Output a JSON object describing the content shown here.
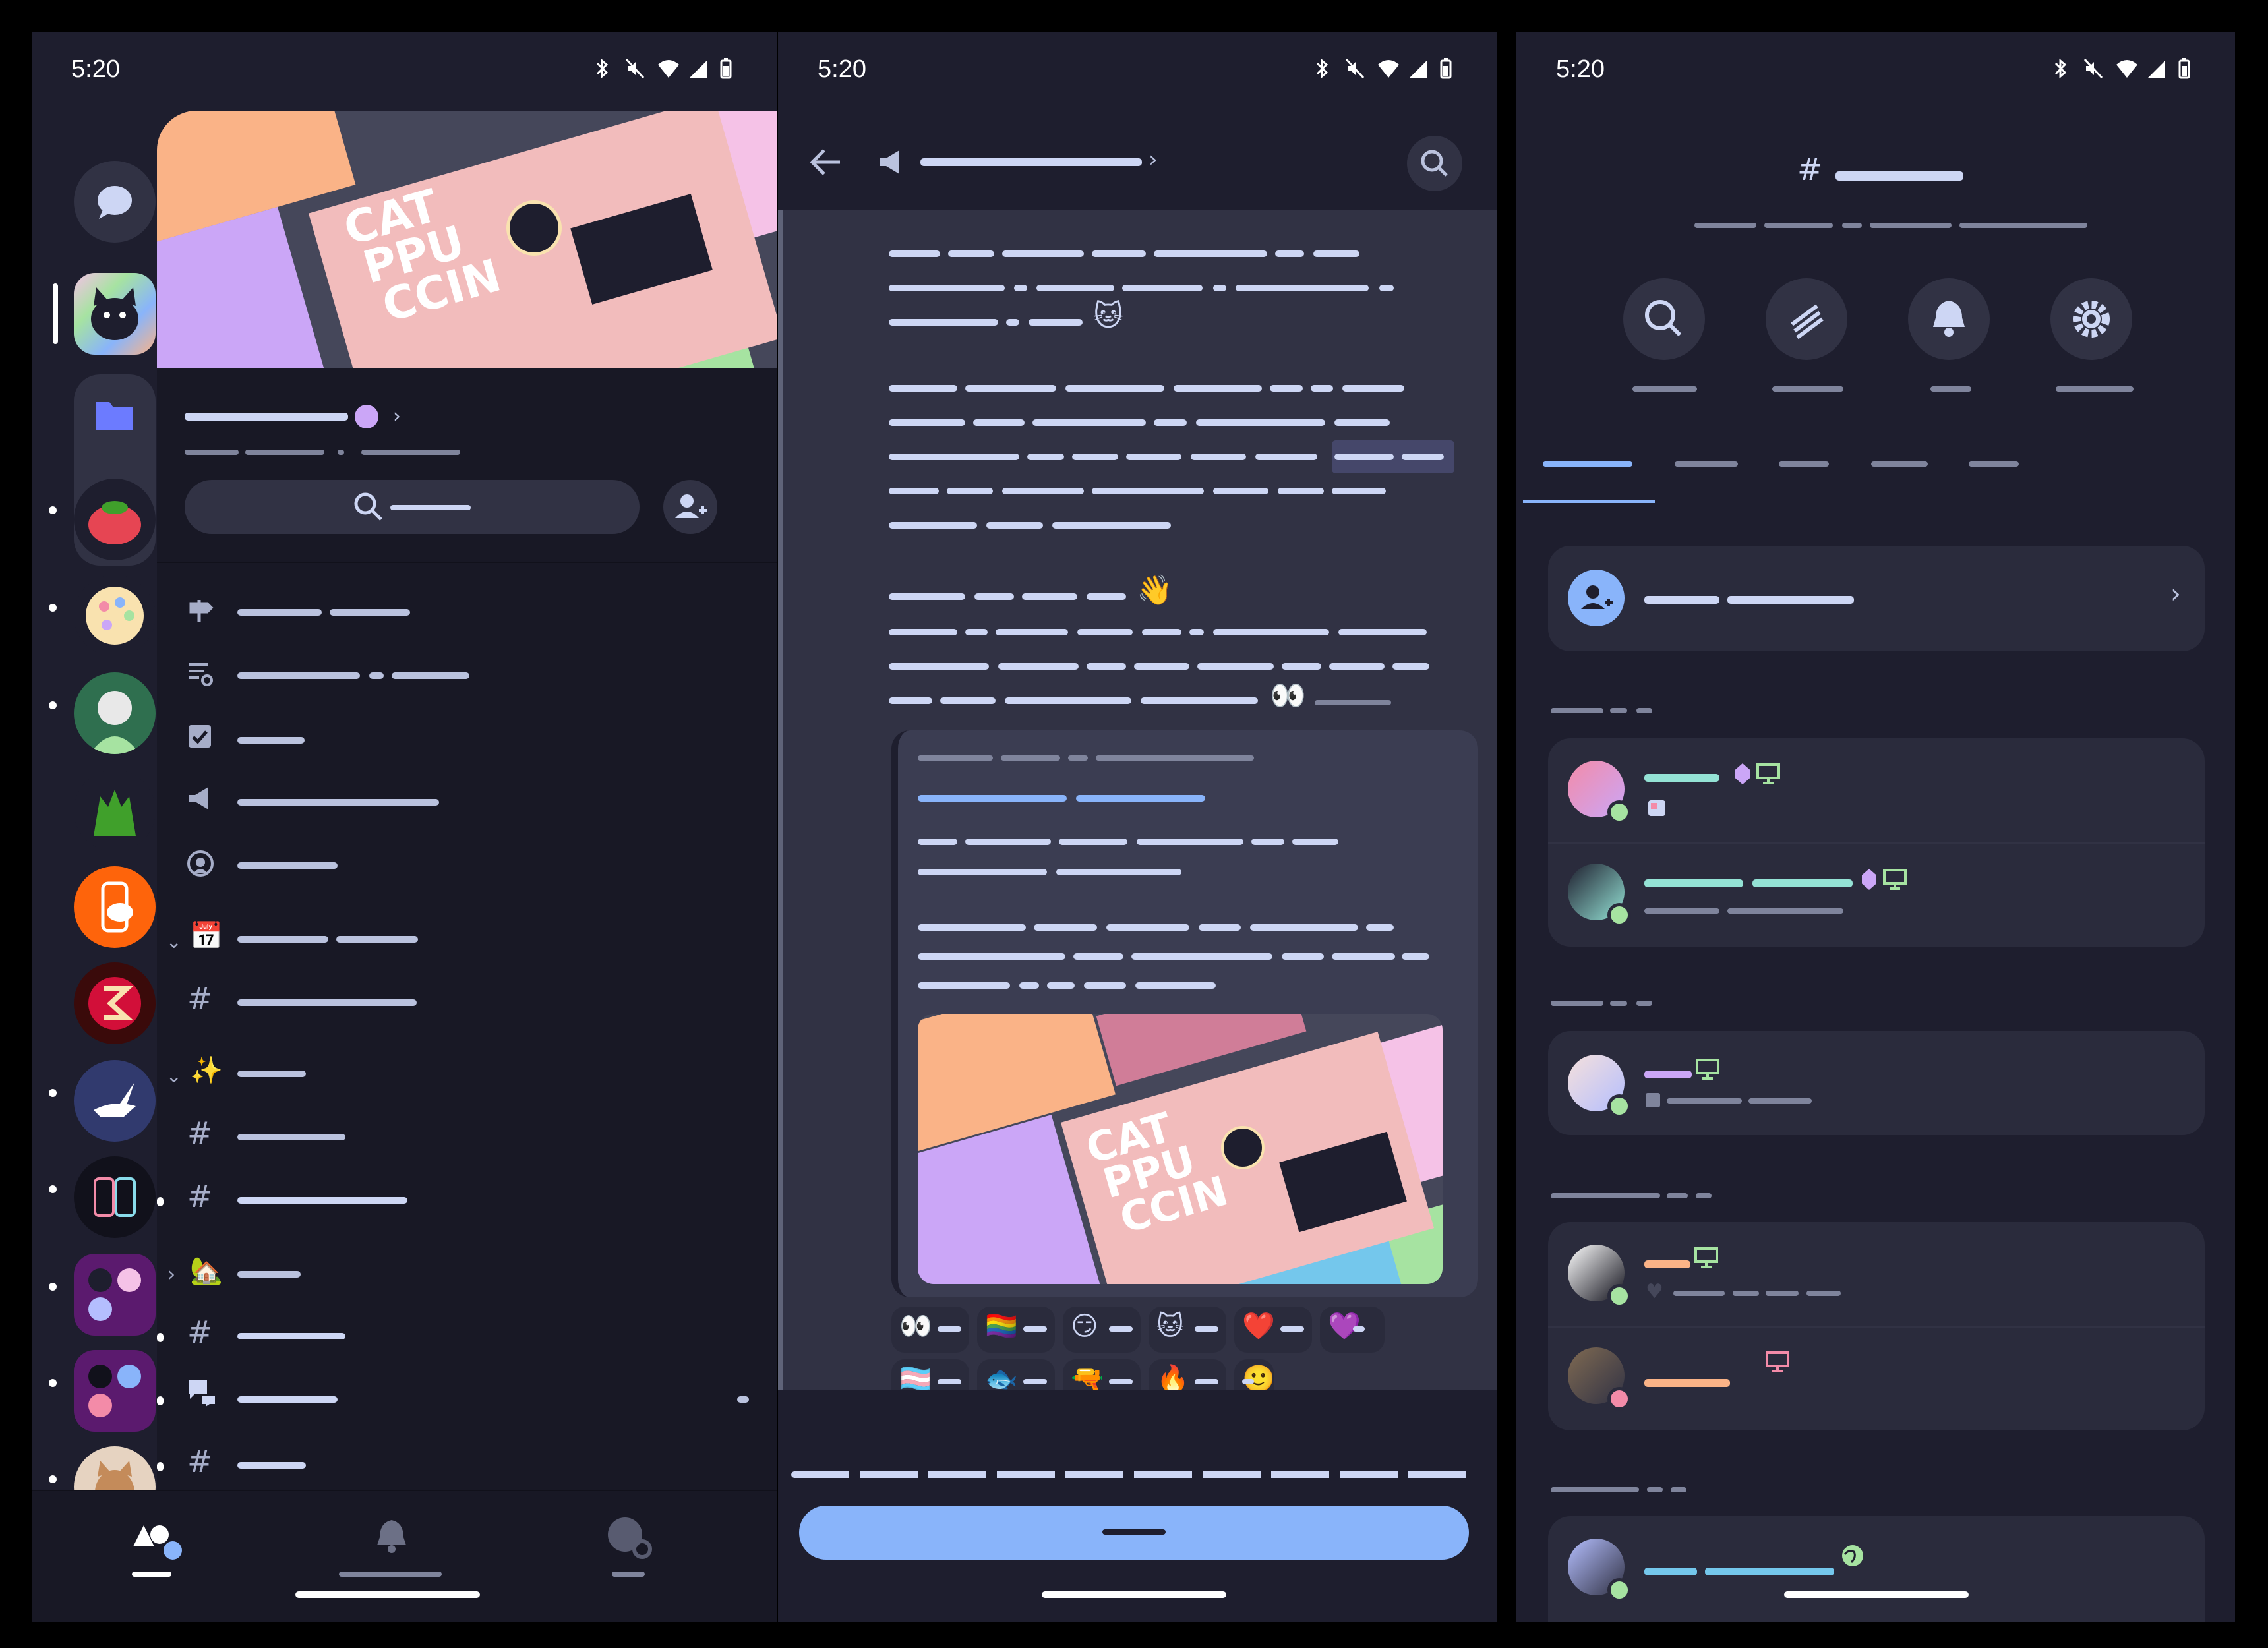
{
  "status_bar": {
    "time": "5:20"
  },
  "banner": {
    "line1": "CAT",
    "line2": "PPU",
    "line3": "CCIN"
  },
  "colors": {
    "base": "#1e1e2e",
    "mantle": "#181825",
    "surface": "#313244",
    "text": "#cdd6f4",
    "subtext": "#bac2de",
    "blue": "#89b4fa",
    "teal": "#94e2d5",
    "mauve": "#cba6f7",
    "peach": "#fab387",
    "green": "#a6e3a1",
    "red": "#f38ba8"
  },
  "icons": {
    "status": [
      "bluetooth-icon",
      "mute-icon",
      "wifi-icon",
      "signal-icon",
      "battery-icon"
    ],
    "nav": [
      "servers-icon",
      "bell-icon",
      "profile-icon"
    ],
    "channel_actions": [
      "search-icon",
      "threads-icon",
      "bell-icon",
      "gear-icon"
    ]
  },
  "reactions_row1": [
    "👀",
    "🏳️‍🌈",
    "😏",
    "🐱",
    "❤️",
    "💜"
  ],
  "reactions_row2": [
    "🏳️‍⚧️",
    "🐟",
    "🔫",
    "🔥",
    "🙂"
  ],
  "emojis": {
    "wave": "👋",
    "eyes": "👀",
    "cat": "🐱",
    "calendar": "📅",
    "sparkles": "✨",
    "house": "🏡"
  }
}
